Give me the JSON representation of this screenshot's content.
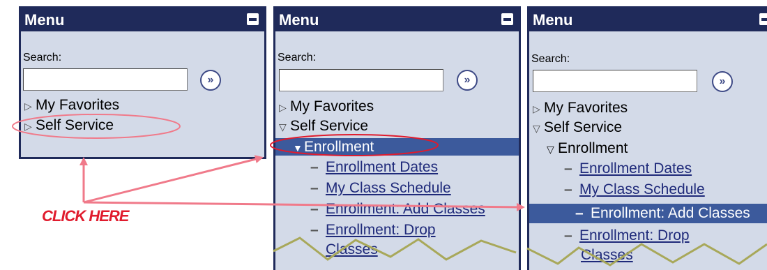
{
  "panels": [
    {
      "title": "Menu",
      "search_label": "Search:",
      "search_value": "",
      "go_glyph": "»",
      "items": [
        {
          "arrow": "▷",
          "label": "My Favorites"
        },
        {
          "arrow": "▷",
          "label": "Self Service"
        }
      ]
    },
    {
      "title": "Menu",
      "search_label": "Search:",
      "search_value": "",
      "go_glyph": "»",
      "items": [
        {
          "arrow": "▷",
          "label": "My Favorites"
        },
        {
          "arrow": "▽",
          "label": "Self Service"
        }
      ],
      "sub": {
        "arrow": "▼",
        "label": "Enrollment",
        "selected": true
      },
      "links": [
        {
          "label": "Enrollment Dates"
        },
        {
          "label": "My Class Schedule"
        },
        {
          "label": "Enrollment: Add Classes"
        },
        {
          "label": "Enrollment: Drop"
        },
        {
          "label": "Classes"
        }
      ]
    },
    {
      "title": "Menu",
      "search_label": "Search:",
      "search_value": "",
      "go_glyph": "»",
      "items": [
        {
          "arrow": "▷",
          "label": "My Favorites"
        },
        {
          "arrow": "▽",
          "label": "Self Service"
        }
      ],
      "sub": {
        "arrow": "▽",
        "label": "Enrollment",
        "selected": false
      },
      "links": [
        {
          "label": "Enrollment Dates"
        },
        {
          "label": "My Class Schedule"
        },
        {
          "label": "Enrollment: Add Classes",
          "selected": true
        },
        {
          "label": "Enrollment: Drop"
        },
        {
          "label": "Classes"
        }
      ]
    }
  ],
  "annotation": {
    "label": "CLICK HERE",
    "color": "#e01b2d"
  },
  "colors": {
    "header": "#1f2a5a",
    "panel_bg": "#d3dae8",
    "selected": "#3c5a9c",
    "link": "#1f2a7a",
    "zigzag": "#a8a85a"
  }
}
